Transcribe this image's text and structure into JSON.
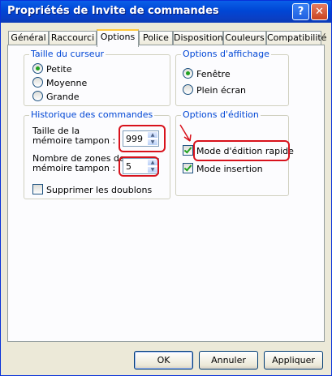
{
  "window": {
    "title": "Propriétés de Invite de commandes",
    "help_button": "?",
    "close_button": "✕"
  },
  "tabs": [
    {
      "label": "Général"
    },
    {
      "label": "Raccourci"
    },
    {
      "label": "Options",
      "active": true
    },
    {
      "label": "Police"
    },
    {
      "label": "Disposition"
    },
    {
      "label": "Couleurs"
    },
    {
      "label": "Compatibilité"
    }
  ],
  "cursor_group": {
    "title": "Taille du curseur",
    "options": [
      {
        "label": "Petite",
        "selected": true
      },
      {
        "label": "Moyenne",
        "selected": false
      },
      {
        "label": "Grande",
        "selected": false
      }
    ]
  },
  "display_group": {
    "title": "Options d'affichage",
    "options": [
      {
        "label": "Fenêtre",
        "selected": true
      },
      {
        "label": "Plein écran",
        "selected": false
      }
    ]
  },
  "history_group": {
    "title": "Historique des commandes",
    "buffer_size_label_1": "Taille de la",
    "buffer_size_label_2": "mémoire tampon :",
    "buffer_size_value": "999",
    "buffer_count_label_1": "Nombre de zones de",
    "buffer_count_label_2": "mémoire tampon :",
    "buffer_count_value": "5",
    "discard_duplicates_label": "Supprimer les doublons",
    "discard_duplicates_checked": false
  },
  "edit_group": {
    "title": "Options d'édition",
    "quick_edit_label": "Mode d'édition rapide",
    "quick_edit_checked": true,
    "insert_mode_label": "Mode insertion",
    "insert_mode_checked": true
  },
  "buttons": {
    "ok": "OK",
    "cancel": "Annuler",
    "apply": "Appliquer"
  },
  "colors": {
    "titlebar": "#0a5fe8",
    "group_title": "#0046d5",
    "annotation": "#d8121c",
    "radio_dot": "#21a121"
  }
}
